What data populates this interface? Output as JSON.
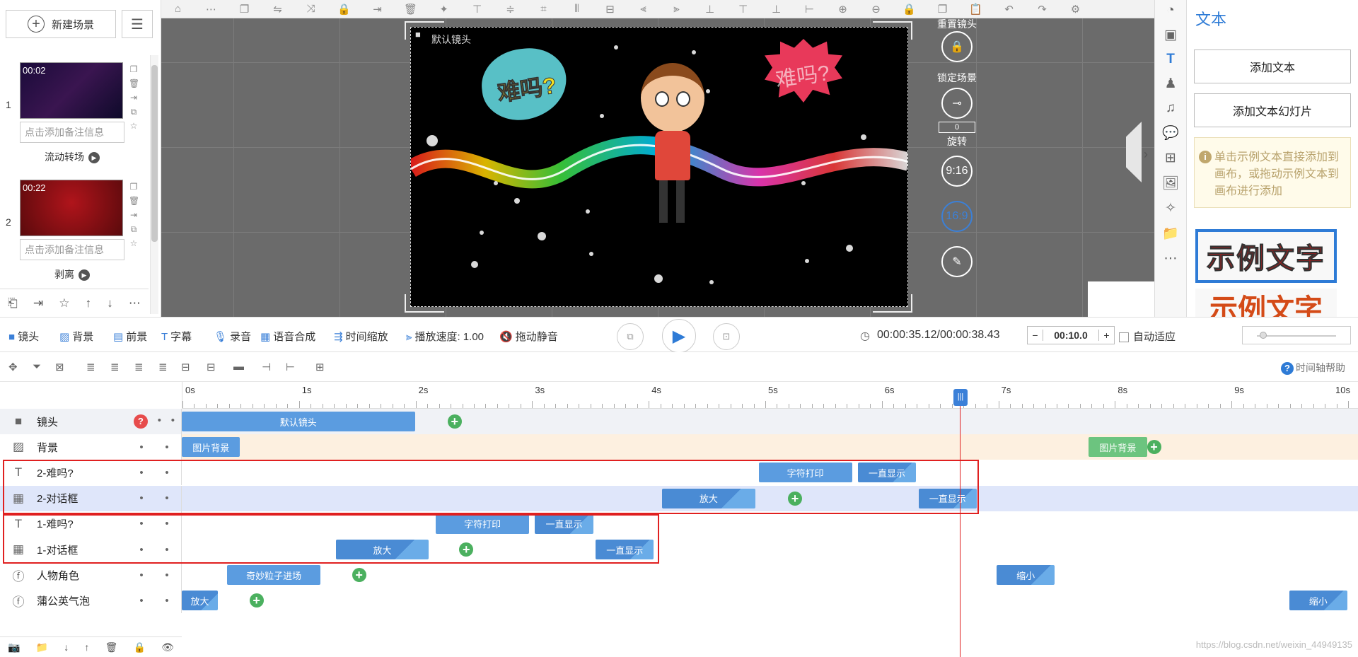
{
  "scene_panel": {
    "new_scene_label": "新建场景",
    "scenes": [
      {
        "index": "1",
        "time": "00:02",
        "note": "点击添加备注信息",
        "transition": "流动转场"
      },
      {
        "index": "2",
        "time": "00:22",
        "note": "点击添加备注信息",
        "transition": "剥离"
      }
    ]
  },
  "stage": {
    "camera_label": "默认镜头",
    "bubble1_text": "难吗?",
    "bubble2_text": "难吗?"
  },
  "side_controls": {
    "reset_camera": "重置镜头",
    "lock_scene": "锁定场景",
    "rotate_value": "0",
    "rotate_label": "旋转",
    "ratio_916": "9:16",
    "ratio_169": "16:9"
  },
  "right_panel": {
    "title": "文本",
    "add_text": "添加文本",
    "add_text_slides": "添加文本幻灯片",
    "tip": "单击示例文本直接添加到画布，或拖动示例文本到画布进行添加",
    "sample_text": "示例文字",
    "sample_text_2": "示例文字"
  },
  "playbar": {
    "camera": "镜头",
    "background": "背景",
    "foreground": "前景",
    "subtitle": "字幕",
    "record": "录音",
    "tts": "语音合成",
    "time_zoom": "时间缩放",
    "speed": "播放速度: 1.00",
    "mute": "拖动静音",
    "time": "00:00:35.12/00:00:38.43",
    "zoom_value": "00:10.0",
    "auto_fit": "自动适应"
  },
  "timeline": {
    "help": "时间轴帮助",
    "ticks": [
      "0s",
      "1s",
      "2s",
      "3s",
      "4s",
      "5s",
      "6s",
      "7s",
      "8s",
      "9s",
      "10s"
    ],
    "tracks": [
      {
        "name": "镜头",
        "icon": "camera-icon",
        "clips": [
          {
            "label": "默认镜头",
            "start": 0,
            "end": 2.0
          }
        ],
        "keyframes": [
          2.28
        ]
      },
      {
        "name": "背景",
        "icon": "background-icon",
        "clips": [
          {
            "label": "图片背景",
            "start": 0,
            "end": 0.5
          },
          {
            "label": "图片背景",
            "start": 7.78,
            "end": 8.28,
            "green": true
          }
        ],
        "keyframes": [
          8.28
        ]
      },
      {
        "name": "2-难吗?",
        "icon": "text-icon",
        "clips": [
          {
            "label": "字符打印",
            "start": 4.95,
            "end": 5.75
          },
          {
            "label": "一直显示",
            "start": 5.8,
            "end": 6.3
          }
        ],
        "keyframes": []
      },
      {
        "name": "2-对话框",
        "icon": "bubble-icon",
        "clips": [
          {
            "label": "放大",
            "start": 4.12,
            "end": 4.92
          },
          {
            "label": "一直显示",
            "start": 6.32,
            "end": 6.82
          }
        ],
        "keyframes": [
          5.2
        ]
      },
      {
        "name": "1-难吗?",
        "icon": "text-icon",
        "clips": [
          {
            "label": "字符打印",
            "start": 2.18,
            "end": 2.98
          },
          {
            "label": "一直显示",
            "start": 3.03,
            "end": 3.53
          }
        ],
        "keyframes": []
      },
      {
        "name": "1-对话框",
        "icon": "bubble-icon",
        "clips": [
          {
            "label": "放大",
            "start": 1.32,
            "end": 2.12
          },
          {
            "label": "一直显示",
            "start": 3.55,
            "end": 4.05
          }
        ],
        "keyframes": [
          2.38
        ]
      },
      {
        "name": "人物角色",
        "icon": "character-icon",
        "clips": [
          {
            "label": "奇妙粒子进场",
            "start": 0.39,
            "end": 1.19
          },
          {
            "label": "缩小",
            "start": 6.99,
            "end": 7.49
          }
        ],
        "keyframes": [
          1.46
        ]
      },
      {
        "name": "蒲公英气泡",
        "icon": "character-icon",
        "clips": [
          {
            "label": "放大",
            "start": 0,
            "end": 0.31
          },
          {
            "label": "缩小",
            "start": 9.5,
            "end": 10.0
          }
        ],
        "keyframes": [
          0.58
        ]
      }
    ],
    "playhead_time": 6.7
  },
  "watermark": "https://blog.csdn.net/weixin_44949135",
  "colors": {
    "accent": "#2e7bd6",
    "clip": "#5b9ce0",
    "keyframe": "#4bb05f",
    "highlight": "#e02020"
  }
}
